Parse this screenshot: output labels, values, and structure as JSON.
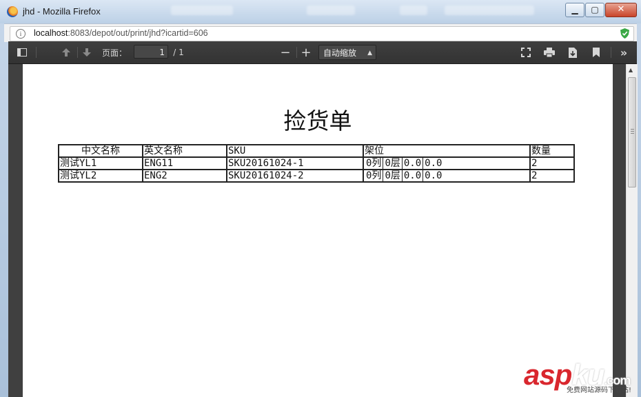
{
  "window": {
    "title": "jhd - Mozilla Firefox"
  },
  "address_bar": {
    "url_host": "localhost",
    "url_rest": ":8083/depot/out/print/jhd?icartid=606"
  },
  "pdf_toolbar": {
    "page_label": "页面：",
    "page_current": "1",
    "page_total": "/ 1",
    "zoom_value": "自动缩放"
  },
  "document": {
    "title": "捡货单",
    "table": {
      "headers": [
        "中文名称",
        "英文名称",
        "SKU",
        "架位",
        "数量"
      ],
      "rows": [
        {
          "cn_name": "测试YL1",
          "en_name": "ENG11",
          "sku": "SKU20161024-1",
          "location": [
            "0列",
            "0层",
            "0.0",
            "0.0"
          ],
          "qty": "2"
        },
        {
          "cn_name": "测试YL2",
          "en_name": "ENG2",
          "sku": "SKU20161024-2",
          "location": [
            "0列",
            "0层",
            "0.0",
            "0.0"
          ],
          "qty": "2"
        }
      ]
    }
  },
  "watermark": {
    "brand_a": "asp",
    "brand_b": "ku",
    "brand_c": ".com",
    "tagline": "免费网站源码下载站!"
  },
  "colors": {
    "toolbar_bg": "#3a3a3a",
    "viewer_bg": "#404040",
    "watermark_red": "#d9272e"
  }
}
